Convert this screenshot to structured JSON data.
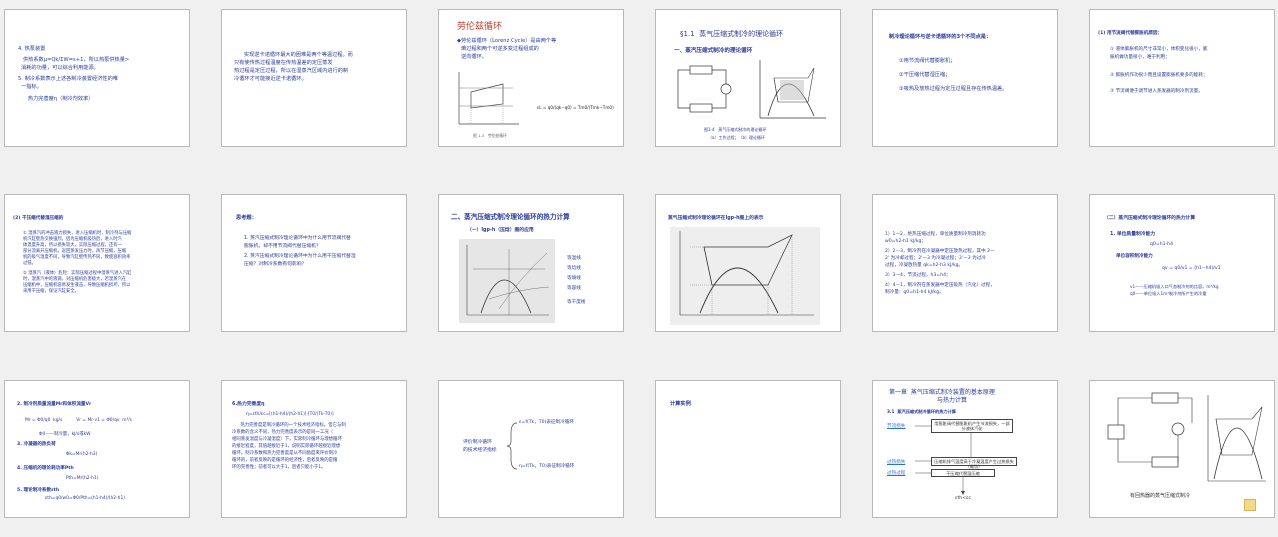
{
  "slides": [
    {
      "id": 1,
      "lines": [
        "4. 热泵装置",
        "   供热系数μ=Qk/ΣW=ε+1，所以热泵供热量>",
        "消耗的功量，可以综合利用能源。",
        "5. 制冷系数表示上述各制冷装置经济性的唯",
        "一指标。",
        "      热力完善度η（制冷剂效率）"
      ]
    },
    {
      "id": 2,
      "lines": [
        "      实现逆卡诺循环最大的困难是两个等温过程。而",
        "只有使传热过程温度在传热温差的定压蒸发",
        "热过程是定压过程，所以在湿蒸汽区域内进行的制",
        "冷循环才可能接近逆卡诺循环。"
      ]
    },
    {
      "id": 3,
      "title": "劳伦兹循环",
      "lines": [
        "◆劳伦兹循环（Lorenz Cycle）是由两个等",
        "熵过程和两个可逆多变过程组成的",
        "逆向循环。"
      ],
      "caption": "图 1-3   劳伦兹循环",
      "formula": "εL = q0/(qk−q0) = Tm0/(Tmk−Tm0)"
    },
    {
      "id": 4,
      "title": "§1.1  蒸气压缩式制冷的理论循环",
      "subtitle": "一、蒸汽压缩式制冷的理论循环",
      "caption1": "图1-4   蒸气压缩式制冷的理论循环",
      "caption2": "（a）工作过程；（b）理论循环"
    },
    {
      "id": 5,
      "title": "制冷理论循环与逆卡诺循环的3个不同点是：",
      "items": [
        "①用节流阀代替膨胀机；",
        "②干压缩代替湿压缩；",
        "③吸热及放热过程为定压过程且存在传热温差。"
      ]
    },
    {
      "id": 6,
      "title": "(1) 用节流阀代替膨胀机原因：",
      "items": [
        "① 液体膨胀机的尺寸非常小，体积变化很小，膨",
        "胀机做功量很小，难于利用；",
        "② 膨胀机作功很少而且设置膨胀机要多的能耗；",
        "③ 节流阀便于调节进入蒸发器的制冷剂流量。"
      ]
    },
    {
      "id": 7,
      "title": "(2) 干压缩代替湿压缩的",
      "items": [
        "① 湿蒸汽的冲击液力损失，进入压缩机时，制冷剂与压缩",
        "机汽缸壁热交换强烈，因为压缩机吸热后，进入时汽",
        "体温度升高，所以损失较大，实际压缩过程，还有一",
        "部分流离开压缩机，返回蒸发压力时，再节压缩，压缩",
        "机的吸气温度不同，导致汽缸壁传热不同，致使容积效率",
        "过低。",
        "② 湿蒸汽（液体）危险：实际压缩过程中湿蒸气进入汽缸",
        "时，湿蒸汽中的液滴，对压缩机危害极大，若湿蒸汽在",
        "压缩机中，压缩机容易发生液击，导致压缩机损坏，所以",
        "采用干压缩，保证汽缸安全。"
      ]
    },
    {
      "id": 8,
      "title": "思考题：",
      "items": [
        "1. 蒸汽压缩式制冷理论循环中为什么用节流阀代替",
        "膨胀机，却不用节流阀代替压缩机？",
        "2. 蒸汽压缩式制冷理论循环中为什么用干压缩代替湿",
        "压缩？对制冷系数有何影响？"
      ]
    },
    {
      "id": 9,
      "title": "二、蒸汽压缩式制冷理论循环的热力计算",
      "subtitle": "（一）lgp-h（压焓）图的应用",
      "legend": [
        "等温线",
        "等焓线",
        "等熵线",
        "等容线",
        "等干度线"
      ]
    },
    {
      "id": 10,
      "title": "蒸气压缩式制冷理论循环在lgp-h图上的表示"
    },
    {
      "id": 11,
      "items": [
        "1）1—2，绝热压缩过程，单位质量制冷剂消耗功",
        "w0=h2-h1 kJ/kg；",
        "2）2—3，制冷剂在冷凝器中定压放热过程，其中 2—",
        "2' 为冷却过程；2'—3 为冷凝过程；3'—3 为过冷",
        "过程，冷凝放热量 qk=h2-h3 kJ/kg。",
        "3）3—4，节流过程，h3=h4；",
        "4）4—1，制冷剂在蒸发器中定压吸热（汽化）过程，",
        "制冷量：q0=h1-h4 kJ/kg。"
      ]
    },
    {
      "id": 12,
      "title": "（二）蒸汽压缩式制冷理论循环的热力计算",
      "sub1": "1. 单位质量制冷能力",
      "f1": "q0=h1-h4",
      "sub2": "单位容积制冷能力",
      "f2": "qv = q0/v1 = (h1−h4)/v1",
      "n1": "v1——压缩机吸入口气态制冷剂的比容，m³/kg",
      "n2": "q0——单位吸入1m³制冷剂所产生的冷量"
    },
    {
      "id": 13,
      "items": [
        "2. 制冷剂质量流量Mr和体积流量Vr",
        "Mr = Φ0/q0  kg/s          Vr = Mr·v1 = Φ0/qv  m³/s",
        "Φ0——制冷量，kJ/s或kW",
        "3. 冷凝器的热负荷",
        "                                   Φk=Mr(h2-h3)",
        "4. 压缩机的理论耗功率Pth",
        "                                   Pth=Mr(h2-h1)",
        "5. 理论制冷系数εth",
        "                    εth=q0/w0=Φ0/Pth=(h1-h4)/(h2-h1)"
      ]
    },
    {
      "id": 14,
      "title": "6.热力完善度η",
      "formula": "η=εth/εc=[(h1-h4)/(h2-h1)]·[T0/(Tk-T0)]",
      "items": [
        "      热力完善度是制冷循环的一个技术经济指标，但它与制",
        "冷系数的含义不同，热力完善度表示的是同一工况（",
        "相同蒸发温度与冷凝温度）下，实际制冷循环与理想循环",
        "的接近程度，其值越接近于1，说明实际循环越接近理想",
        "循环。制冷系数和热力完善度是从不同角度来评价制冷",
        "循环的，前者反映的是循环的经济性，后者反映的是循",
        "环的完善性；前者可以大于1，后者只能小于1。"
      ]
    },
    {
      "id": 15,
      "left": [
        "评价制冷循环",
        "的技术经济指标"
      ],
      "top": "ε=f(Tk，T0)表征制冷循环",
      "bottom": "η=f(Tk，T0)表征制冷循环"
    },
    {
      "id": 16,
      "title": "计算实例"
    },
    {
      "id": 17,
      "title": "第一章  蒸气压缩式制冷装置的基本原理",
      "title2": "与热力计算",
      "sub": "3.1  蒸汽压缩式制冷循环的热力计算",
      "links": [
        "节流损失",
        "过热损失",
        "过热过程"
      ],
      "boxes": [
        "用膨胀阀代替膨胀机产生节流损失，一部分液体汽化",
        "压缩机排气温度高于冷凝温度产生过热损失（做功）",
        "干压缩代替湿压缩"
      ],
      "result": "εth<εc"
    },
    {
      "id": 18,
      "caption": "有回热器的蒸气压缩式制冷"
    }
  ],
  "colors": {
    "text": "#2a3a9a",
    "title_red": "#c0392b",
    "border": "#b9b9b9",
    "background": "#f0f0f0",
    "note_yellow": "#f5d98a"
  }
}
